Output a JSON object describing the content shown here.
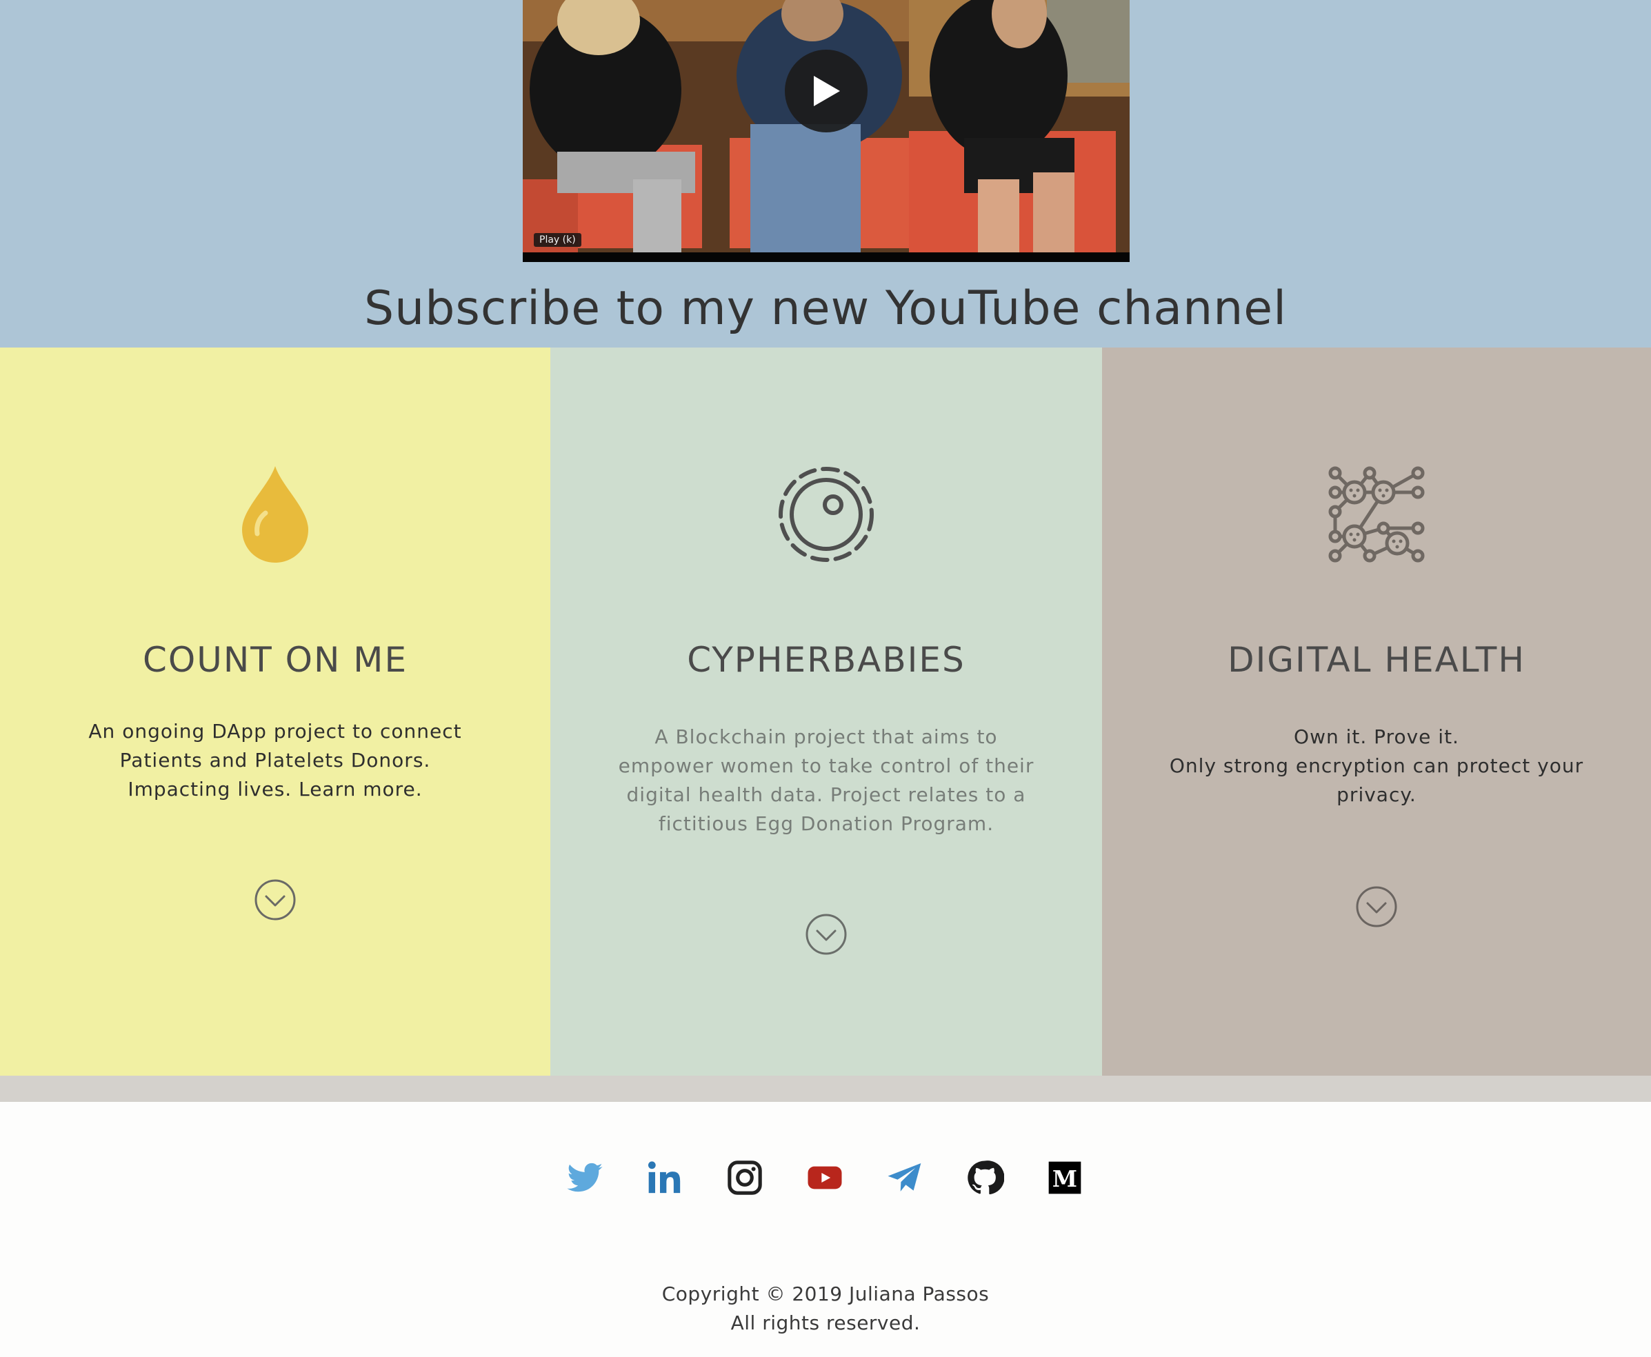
{
  "video": {
    "play_tooltip": "Play (k)"
  },
  "subscribe": {
    "title": "Subscribe to my new YouTube channel"
  },
  "projects": [
    {
      "icon": "blood-drop-icon",
      "title": "COUNT ON ME",
      "description_lines": [
        "An ongoing DApp project to connect",
        "Patients and Platelets Donors.",
        "Impacting lives.  Learn more."
      ],
      "bg": "#f1f0a3",
      "accent": "#e8bb3c"
    },
    {
      "icon": "egg-cell-icon",
      "title": "CYPHERBABIES",
      "description_lines": [
        "A Blockchain project that aims to",
        "empower women to take control of their",
        "digital health data. Project relates to a",
        "fictitious Egg Donation Program."
      ],
      "bg": "#ceddcf",
      "accent": "#4f4f4f"
    },
    {
      "icon": "network-nodes-icon",
      "title": "DIGITAL HEALTH",
      "description_lines": [
        "Own it. Prove it.",
        "Only strong encryption can protect your",
        "privacy."
      ],
      "bg": "#c1b7ae",
      "accent": "#6f6862"
    }
  ],
  "social": [
    {
      "name": "twitter-icon",
      "color": "#5ea9dd"
    },
    {
      "name": "linkedin-icon",
      "color": "#2a77b5"
    },
    {
      "name": "instagram-icon",
      "color": "#222222"
    },
    {
      "name": "youtube-icon",
      "color": "#b8261c"
    },
    {
      "name": "telegram-icon",
      "color": "#3d8ccb"
    },
    {
      "name": "github-icon",
      "color": "#1b1b1b"
    },
    {
      "name": "medium-icon",
      "color": "#000000"
    }
  ],
  "footer": {
    "copyright": "Copyright © 2019 Juliana Passos",
    "rights": "All rights reserved."
  }
}
